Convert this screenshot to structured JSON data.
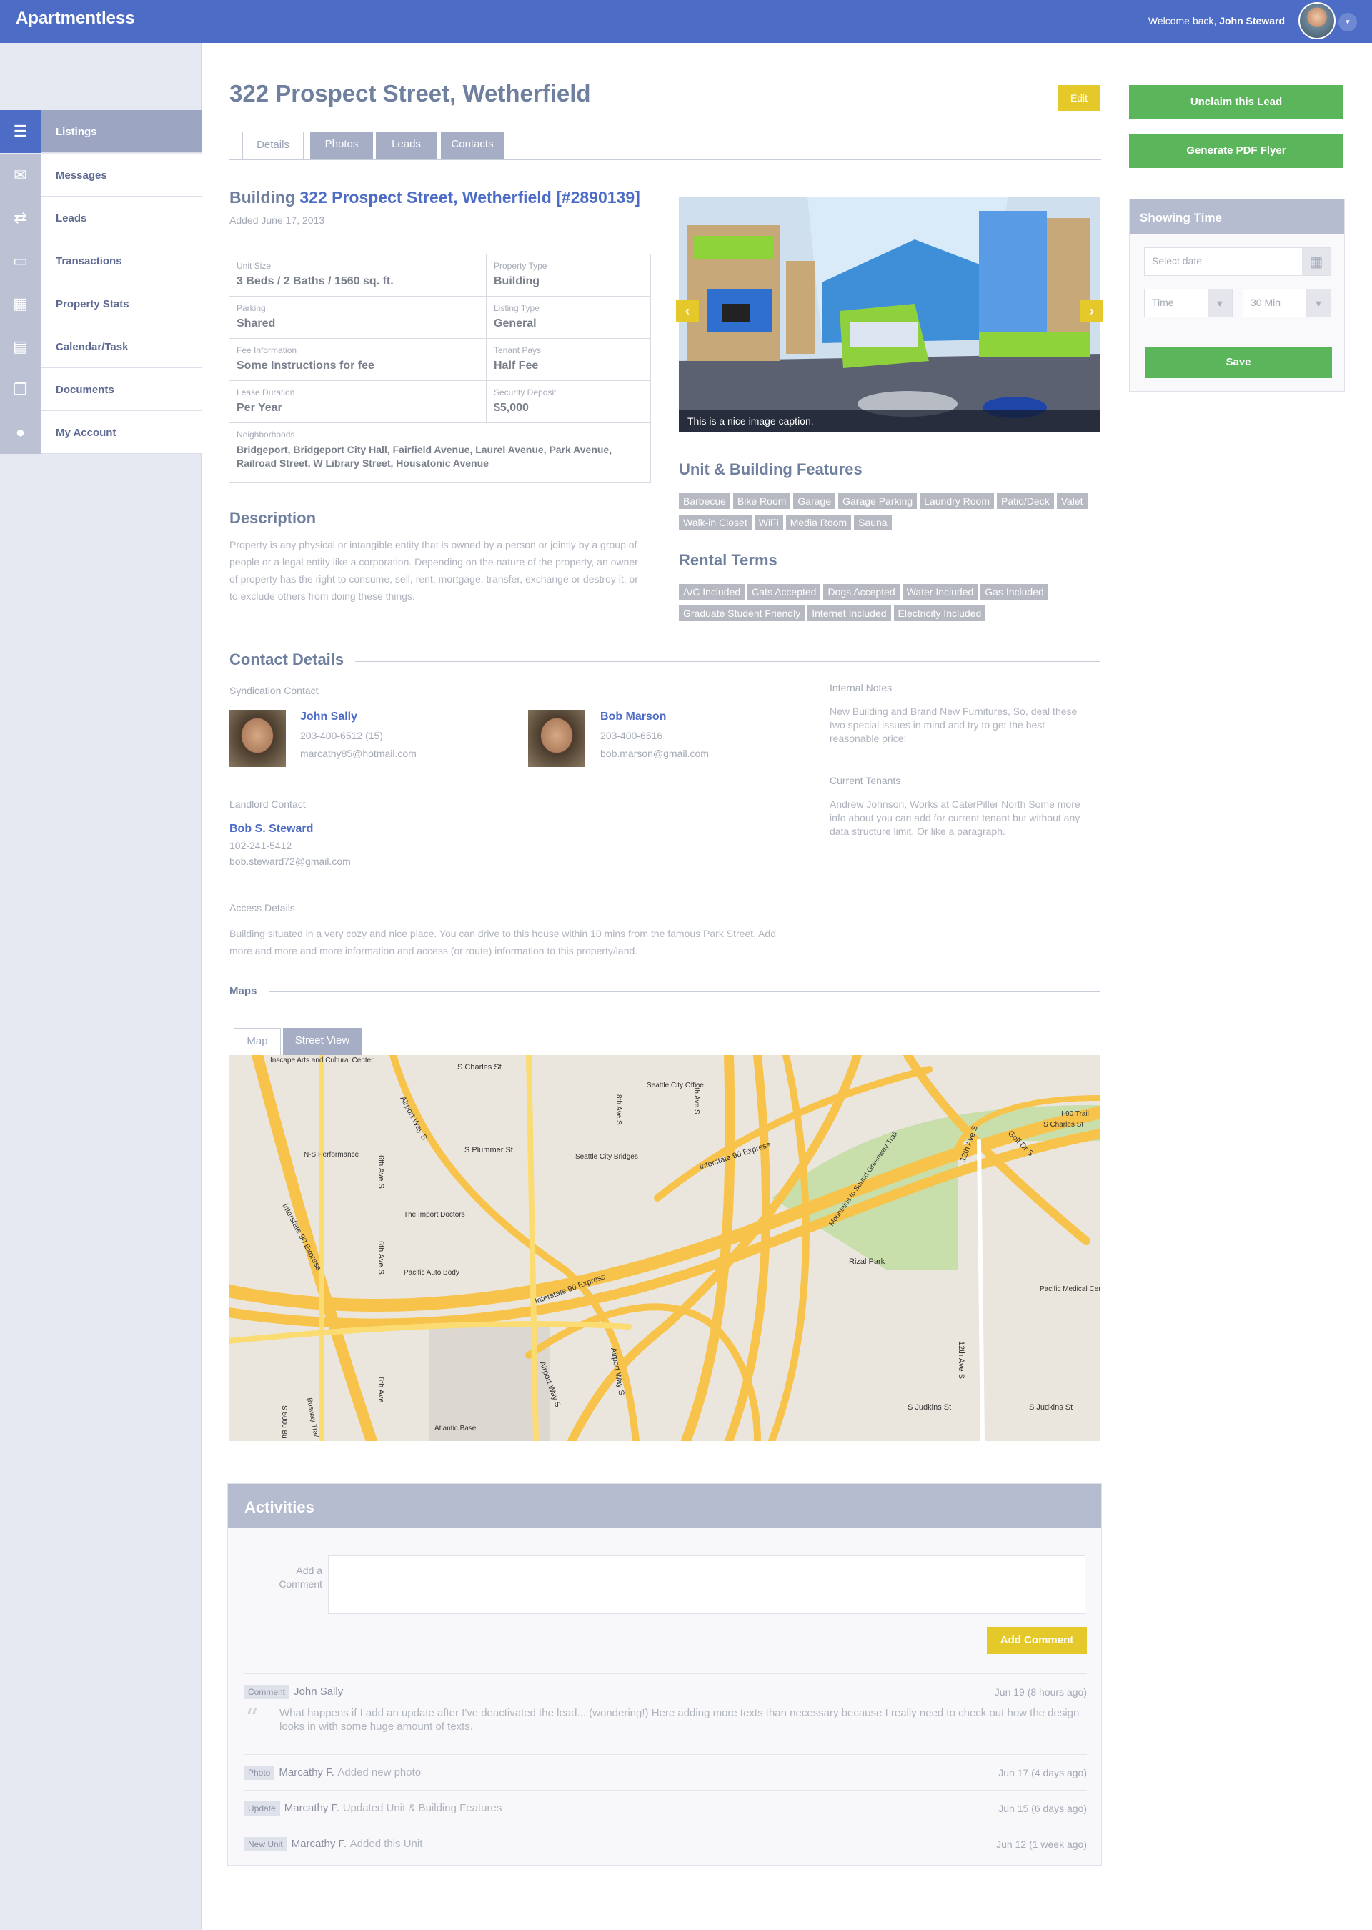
{
  "app": {
    "name": "Apartmentless",
    "welcome_prefix": "Welcome back, ",
    "user_name": "John Steward",
    "dropdown_glyph": "▾"
  },
  "sidebar": {
    "items": [
      {
        "label": "Listings",
        "icon": "list-icon",
        "glyph": "☰"
      },
      {
        "label": "Messages",
        "icon": "envelope-icon",
        "glyph": "✉"
      },
      {
        "label": "Leads",
        "icon": "repeat-icon",
        "glyph": "⇄"
      },
      {
        "label": "Transactions",
        "icon": "money-icon",
        "glyph": "▭"
      },
      {
        "label": "Property Stats",
        "icon": "bar-chart-icon",
        "glyph": "▦"
      },
      {
        "label": "Calendar/Task",
        "icon": "calendar-icon",
        "glyph": "▤"
      },
      {
        "label": "Documents",
        "icon": "documents-icon",
        "glyph": "❐"
      },
      {
        "label": "My Account",
        "icon": "user-icon",
        "glyph": "●"
      }
    ]
  },
  "page": {
    "title": "322 Prospect Street, Wetherfield",
    "edit_label": "Edit",
    "tabs": [
      "Details",
      "Photos",
      "Leads",
      "Contacts"
    ]
  },
  "actions": {
    "unclaim": "Unclaim this Lead",
    "pdf": "Generate PDF Flyer"
  },
  "showing": {
    "title": "Showing Time",
    "date_placeholder": "Select date",
    "time_placeholder": "Time",
    "duration": "30 Min",
    "save": "Save"
  },
  "building": {
    "prefix": "Building ",
    "name": "322 Prospect Street, Wetherfield [#2890139]",
    "added": "Added June 17, 2013"
  },
  "properties": [
    {
      "k": "Unit Size",
      "v": "3 Beds / 2 Baths / 1560 sq. ft."
    },
    {
      "k": "Property Type",
      "v": "Building"
    },
    {
      "k": "Parking",
      "v": "Shared"
    },
    {
      "k": "Listing Type",
      "v": "General"
    },
    {
      "k": "Fee Information",
      "v": "Some Instructions for fee"
    },
    {
      "k": "Tenant Pays",
      "v": "Half Fee"
    },
    {
      "k": "Lease Duration",
      "v": "Per Year"
    },
    {
      "k": "Security Deposit",
      "v": "$5,000"
    },
    {
      "k": "Neighborhoods",
      "v": "Bridgeport, Bridgeport City Hall, Fairfield Avenue, Laurel Avenue, Park Avenue, Railroad Street, W Library Street, Housatonic Avenue"
    }
  ],
  "description": {
    "title": "Description",
    "text": "Property is any physical or intangible entity that is owned by a person or jointly by a group of people or a legal entity like a corporation. Depending on the nature of the property, an owner of property has the right to consume, sell, rent, mortgage, transfer, exchange or destroy it, or to exclude others from doing these things."
  },
  "gallery": {
    "caption": "This is a nice image caption.",
    "prev": "‹",
    "next": "›"
  },
  "features": {
    "title": "Unit & Building Features",
    "items": [
      "Barbecue",
      "Bike Room",
      "Garage",
      "Garage Parking",
      "Laundry Room",
      "Patio/Deck",
      "Valet",
      "Walk-in Closet",
      "WiFi",
      "Media Room",
      "Sauna"
    ]
  },
  "rental": {
    "title": "Rental Terms",
    "items": [
      "A/C Included",
      "Cats Accepted",
      "Dogs Accepted",
      "Water Included",
      "Gas Included",
      "Graduate Student Friendly",
      "Internet Included",
      "Electricity Included"
    ]
  },
  "contact": {
    "title": "Contact Details",
    "syndication_label": "Syndication Contact",
    "people": [
      {
        "name": "John Sally",
        "phone": "203-400-6512 (15)",
        "email": "marcathy85@hotmail.com"
      },
      {
        "name": "Bob Marson",
        "phone": "203-400-6516",
        "email": "bob.marson@gmail.com"
      }
    ],
    "landlord_label": "Landlord Contact",
    "landlord": {
      "name": "Bob S. Steward",
      "phone": "102-241-5412",
      "email": "bob.steward72@gmail.com"
    },
    "access_label": "Access Details",
    "access_text": "Building situated in a very cozy and nice place. You can drive to this house within 10 mins from the famous Park Street. Add more and more and more information and access (or route) information to this property/land.",
    "internal_label": "Internal Notes",
    "internal_text": "New Building and Brand New Furnitures, So, deal these two special issues in mind and try to get the best reasonable price!",
    "tenants_label": "Current Tenants",
    "tenants_text": "Andrew Johnson, Works at CaterPiller North Some more info about you can add for current tenant but without any data structure limit. Or like a paragraph."
  },
  "maps": {
    "title": "Maps",
    "tab_map": "Map",
    "tab_street": "Street View",
    "labels": {
      "interstate1": "Interstate 90 Express",
      "interstate2": "Interstate 90 Express",
      "interstate3": "Interstate 90 Express",
      "charles": "S Charles St",
      "plummer": "S Plummer St",
      "judkins1": "S Judkins St",
      "judkins2": "S Judkins St",
      "airport1": "Airport Way S",
      "airport2": "Airport Way S",
      "airport3": "Airport Way S",
      "ave6a": "6th Ave S",
      "ave6b": "6th Ave S",
      "ave6c": "6th Ave",
      "ave12a": "12th Ave S",
      "ave12b": "12th Ave S",
      "golf": "Golf Dr S",
      "rizal": "Rizal Park",
      "mountains": "Mountains to Sound Greenway Trail",
      "inscape": "Inscape Arts and Cultural Center",
      "seattle_office": "Seattle City Office",
      "bridges": "Seattle City Bridges",
      "import": "The Import Doctors",
      "pacific": "Pacific Auto Body",
      "ns": "N-S Performance",
      "atlantic": "Atlantic Base",
      "medical": "Pacific Medical Center Beacon Hi",
      "ave9": "9th Ave S",
      "ave8": "8th Ave S",
      "trail190": "I-90 Trail",
      "charles2": "S Charles St",
      "s5000": "S 5000 Bu",
      "busway": "Busway Trail"
    }
  },
  "activities": {
    "title": "Activities",
    "add_label": "Add a Comment",
    "add_button": "Add Comment",
    "items": [
      {
        "badge": "Comment",
        "name": "John Sally",
        "text": "",
        "date": "Jun 19 (8 hours ago)",
        "quote": "What happens if I add an update after I've deactivated the lead... (wondering!) Here adding more texts than necessary because I really need to check out how the design looks in with some huge amount of texts."
      },
      {
        "badge": "Photo",
        "name": "Marcathy F.",
        "text": "Added new photo",
        "date": "Jun 17 (4 days ago)"
      },
      {
        "badge": "Update",
        "name": "Marcathy F.",
        "text": "Updated Unit & Building Features",
        "date": "Jun 15 (6 days ago)"
      },
      {
        "badge": "New Unit",
        "name": "Marcathy F.",
        "text": "Added this Unit",
        "date": "Jun 12 (1 week ago)"
      }
    ]
  }
}
